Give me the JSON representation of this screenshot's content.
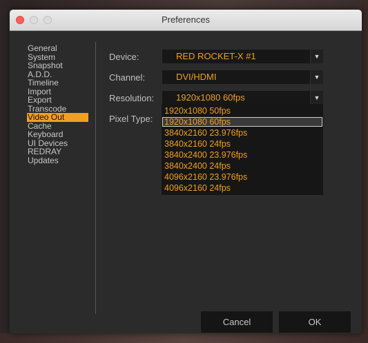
{
  "window": {
    "title": "Preferences"
  },
  "sidebar": {
    "items": [
      {
        "label": "General"
      },
      {
        "label": "System"
      },
      {
        "label": "Snapshot"
      },
      {
        "label": "A.D.D."
      },
      {
        "label": "Timeline"
      },
      {
        "label": "Import"
      },
      {
        "label": "Export"
      },
      {
        "label": "Transcode"
      },
      {
        "label": "Video Out",
        "selected": true
      },
      {
        "label": "Cache"
      },
      {
        "label": "Keyboard"
      },
      {
        "label": "UI Devices"
      },
      {
        "label": "REDRAY"
      },
      {
        "label": "Updates"
      }
    ]
  },
  "form": {
    "device": {
      "label": "Device:",
      "value": "RED ROCKET-X #1"
    },
    "channel": {
      "label": "Channel:",
      "value": "DVI/HDMI"
    },
    "resolution": {
      "label": "Resolution:",
      "value": "1920x1080 60fps",
      "options": [
        "1920x1080 50fps",
        "1920x1080 60fps",
        "3840x2160 23.976fps",
        "3840x2160 24fps",
        "3840x2400 23.976fps",
        "3840x2400 24fps",
        "4096x2160 23.976fps",
        "4096x2160 24fps"
      ],
      "selected_index": 1
    },
    "pixel_type": {
      "label": "Pixel Type:"
    }
  },
  "buttons": {
    "cancel": "Cancel",
    "ok": "OK"
  },
  "icons": {
    "dropdown_arrow": "chevron-down-icon",
    "close": "close-icon",
    "minimize": "minimize-icon",
    "maximize": "maximize-icon"
  },
  "colors": {
    "accent": "#f0a020",
    "background": "#2b2b2b",
    "select_bg": "#171717"
  }
}
